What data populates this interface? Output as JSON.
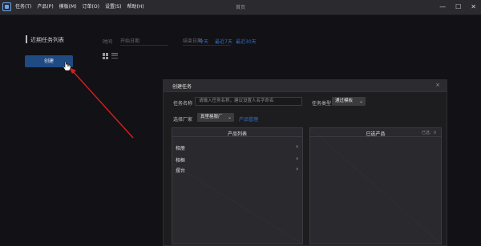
{
  "app": {
    "icon": "app-logo-icon",
    "title": "首页",
    "menu": [
      "任务(T)",
      "产品(P)",
      "模板(M)",
      "订单(O)",
      "设置(S)",
      "帮助(H)"
    ],
    "window_controls": [
      "—",
      "☐",
      "✕"
    ]
  },
  "main": {
    "section_title": "近期任务列表",
    "filter_label": "时间",
    "date_start_placeholder": "开始日期",
    "date_end_placeholder": "结束日期",
    "quick_links": [
      "今天",
      "最近7天",
      "最近30天"
    ],
    "create_button": "创建",
    "view_icons": [
      "grid-view-icon",
      "list-view-icon"
    ]
  },
  "dialog": {
    "title": "创建任务",
    "close": "×",
    "task_name_label": "任务名称",
    "task_name_placeholder": "请输入任务名称，建议设置人名字命名",
    "task_type_label": "任务类型",
    "task_type_value": "通过模板",
    "factory_label": "选择厂家",
    "factory_value": "真里格服厂",
    "product_manage_link": "产品管理",
    "product_list_title": "产品列表",
    "products": [
      {
        "name": "相册"
      },
      {
        "name": "相框"
      },
      {
        "name": "摆台"
      }
    ],
    "selected_title": "已选产品",
    "selected_count": "已选：0"
  },
  "colors": {
    "background": "#121115",
    "menubar": "#2b2b2f",
    "primary_button": "#1f4a82",
    "link": "#2f6fc8",
    "annotation_arrow": "#d42020"
  }
}
